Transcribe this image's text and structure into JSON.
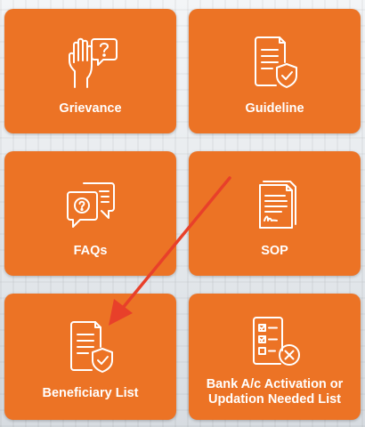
{
  "tiles": {
    "grievance": {
      "label": "Grievance",
      "icon": "grievance-hand-chat-icon"
    },
    "guideline": {
      "label": "Guideline",
      "icon": "guideline-document-shield-icon"
    },
    "faqs": {
      "label": "FAQs",
      "icon": "faq-chat-bubbles-icon"
    },
    "sop": {
      "label": "SOP",
      "icon": "sop-documents-icon"
    },
    "beneficiary": {
      "label": "Beneficiary List",
      "icon": "beneficiary-document-shield-icon"
    },
    "bank": {
      "label": "Bank A/c Activation or Updation Needed List",
      "icon": "checklist-cancel-icon"
    }
  },
  "colors": {
    "tile": "#ec7325",
    "text": "#ffffff",
    "annotation_arrow": "#e8402a"
  }
}
